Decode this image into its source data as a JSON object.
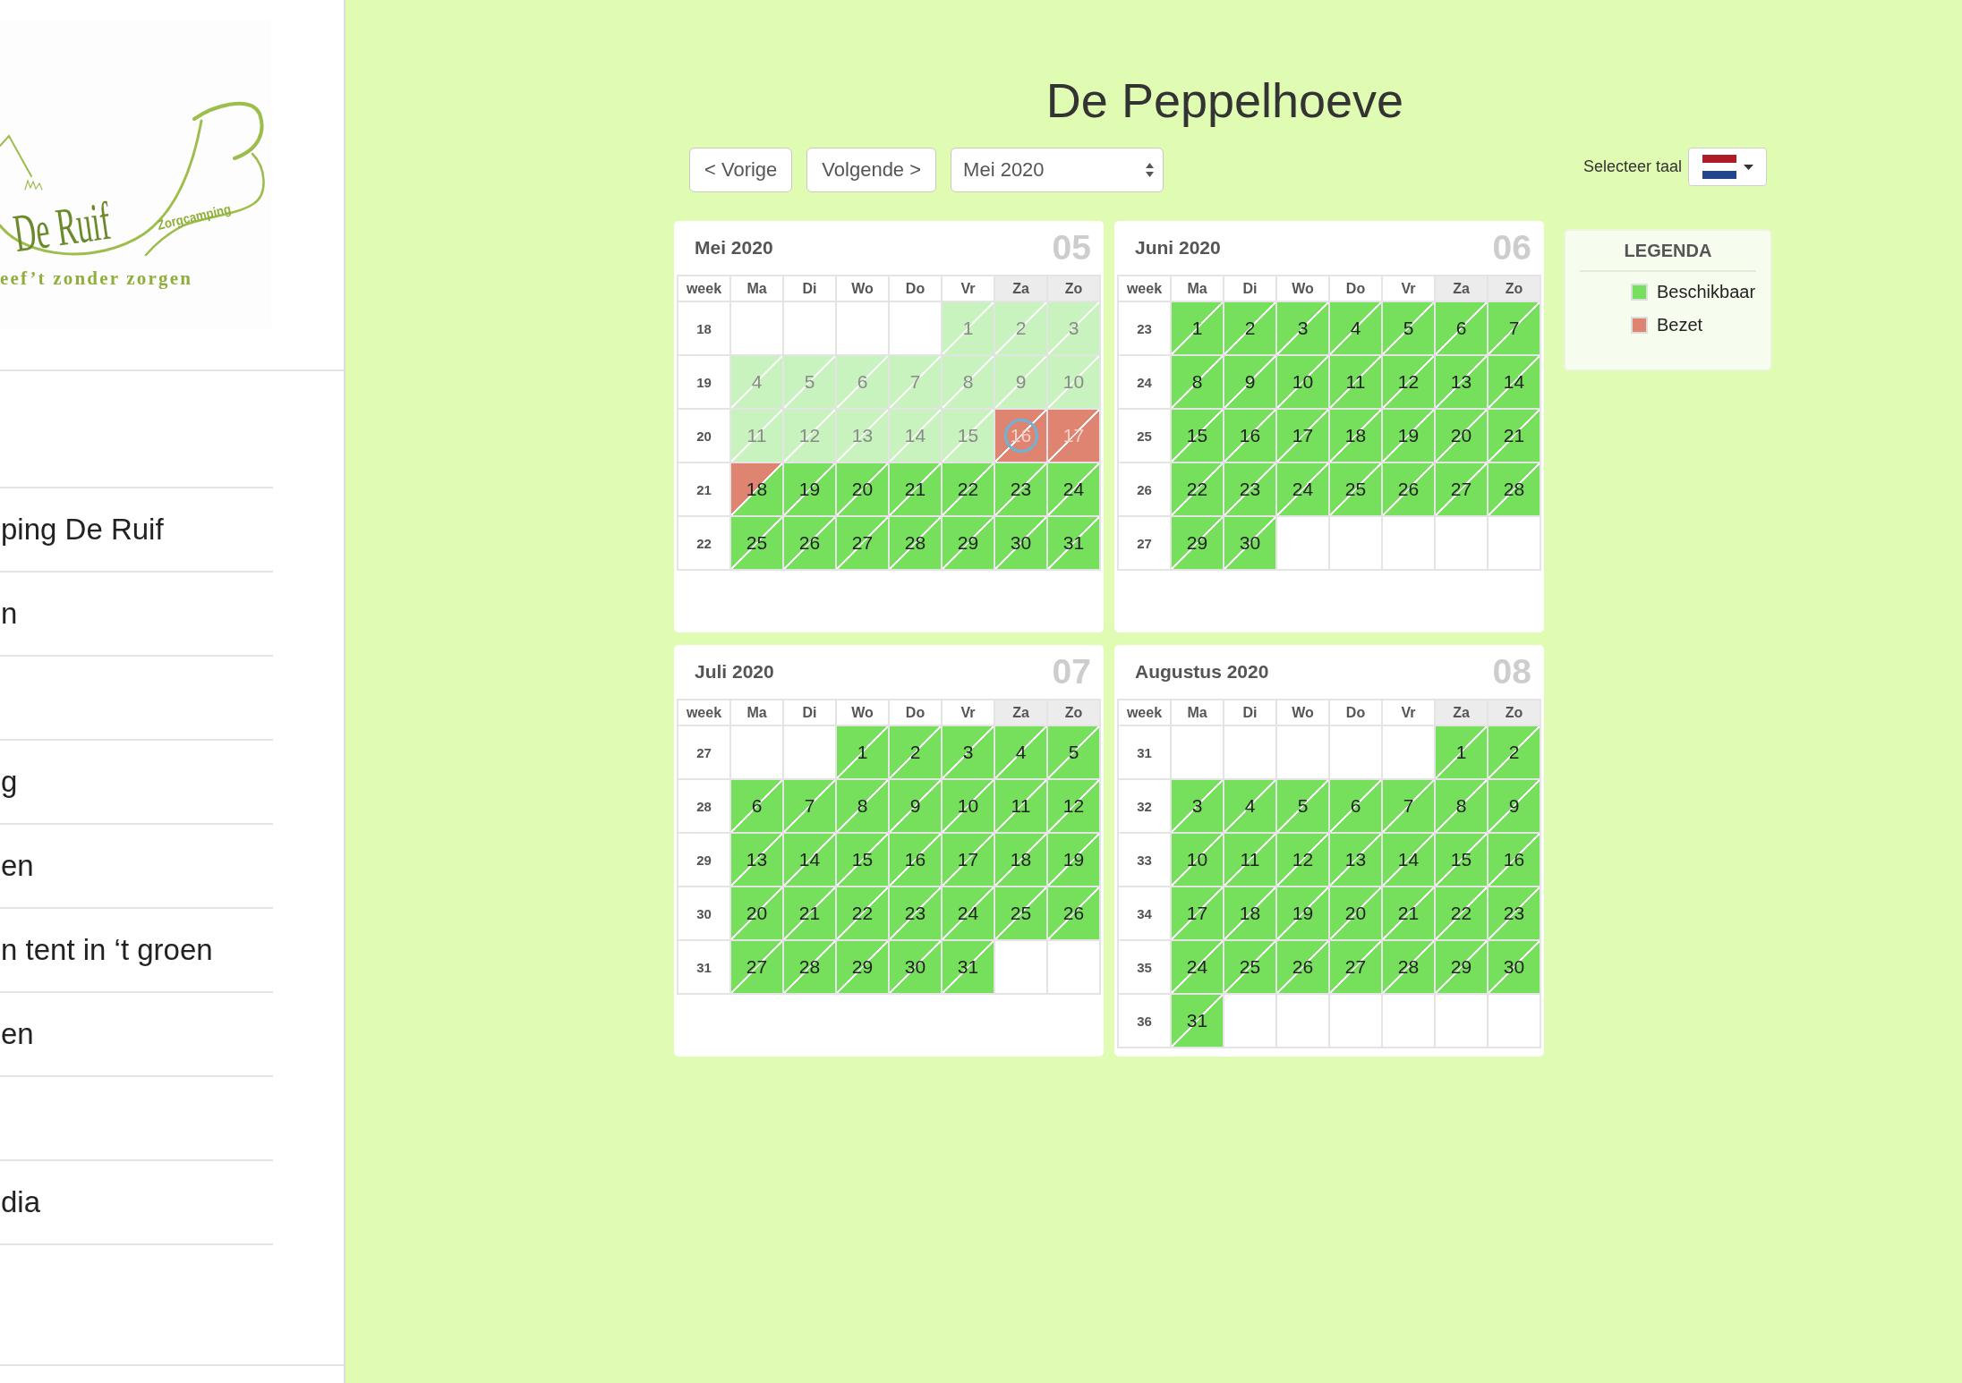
{
  "sidebar": {
    "logo": {
      "name": "De Ruif",
      "tag": "Zorgcamping",
      "slogan": "eef’t zonder zorgen"
    },
    "menu": [
      {
        "kind": "blank"
      },
      {
        "kind": "link",
        "label": "ping De Ruif"
      },
      {
        "kind": "link",
        "label": "n"
      },
      {
        "kind": "blank"
      },
      {
        "kind": "link",
        "label": "g"
      },
      {
        "kind": "link",
        "label": "en"
      },
      {
        "kind": "link",
        "label": "n tent in ‘t groen"
      },
      {
        "kind": "link",
        "label": "en"
      },
      {
        "kind": "blank"
      },
      {
        "kind": "link",
        "label": "dia"
      },
      {
        "kind": "blank"
      }
    ]
  },
  "page": {
    "title": "De Peppelhoeve"
  },
  "toolbar": {
    "previous": "< Vorige",
    "next": "Volgende >",
    "month_select": {
      "value": "Mei 2020"
    },
    "language_label": "Selecteer taal"
  },
  "calendars": [
    {
      "title": "Mei 2020",
      "number": "05",
      "header": [
        {
          "label": "week",
          "shaded": false
        },
        {
          "label": "Ma",
          "shaded": false
        },
        {
          "label": "Di",
          "shaded": false
        },
        {
          "label": "Wo",
          "shaded": false
        },
        {
          "label": "Do",
          "shaded": false
        },
        {
          "label": "Vr",
          "shaded": false
        },
        {
          "label": "Za",
          "shaded": true
        },
        {
          "label": "Zo",
          "shaded": true
        }
      ],
      "weeks": [
        {
          "week": "18",
          "days": [
            {
              "kind": "blank"
            },
            {
              "kind": "blank"
            },
            {
              "kind": "blank"
            },
            {
              "kind": "blank"
            },
            {
              "kind": "day",
              "label": "1",
              "top_booked": false,
              "bottom_booked": false,
              "disabled": true,
              "today": false
            },
            {
              "kind": "day",
              "label": "2",
              "top_booked": false,
              "bottom_booked": false,
              "disabled": true,
              "today": false
            },
            {
              "kind": "day",
              "label": "3",
              "top_booked": false,
              "bottom_booked": false,
              "disabled": true,
              "today": false
            }
          ]
        },
        {
          "week": "19",
          "days": [
            {
              "kind": "day",
              "label": "4",
              "top_booked": false,
              "bottom_booked": false,
              "disabled": true,
              "today": false
            },
            {
              "kind": "day",
              "label": "5",
              "top_booked": false,
              "bottom_booked": false,
              "disabled": true,
              "today": false
            },
            {
              "kind": "day",
              "label": "6",
              "top_booked": false,
              "bottom_booked": false,
              "disabled": true,
              "today": false
            },
            {
              "kind": "day",
              "label": "7",
              "top_booked": false,
              "bottom_booked": false,
              "disabled": true,
              "today": false
            },
            {
              "kind": "day",
              "label": "8",
              "top_booked": false,
              "bottom_booked": false,
              "disabled": true,
              "today": false
            },
            {
              "kind": "day",
              "label": "9",
              "top_booked": false,
              "bottom_booked": false,
              "disabled": true,
              "today": false
            },
            {
              "kind": "day",
              "label": "10",
              "top_booked": false,
              "bottom_booked": false,
              "disabled": true,
              "today": false
            }
          ]
        },
        {
          "week": "20",
          "days": [
            {
              "kind": "day",
              "label": "11",
              "top_booked": false,
              "bottom_booked": false,
              "disabled": true,
              "today": false
            },
            {
              "kind": "day",
              "label": "12",
              "top_booked": false,
              "bottom_booked": false,
              "disabled": true,
              "today": false
            },
            {
              "kind": "day",
              "label": "13",
              "top_booked": false,
              "bottom_booked": false,
              "disabled": true,
              "today": false
            },
            {
              "kind": "day",
              "label": "14",
              "top_booked": false,
              "bottom_booked": false,
              "disabled": true,
              "today": false
            },
            {
              "kind": "day",
              "label": "15",
              "top_booked": false,
              "bottom_booked": false,
              "disabled": true,
              "today": false
            },
            {
              "kind": "day",
              "label": "16",
              "top_booked": true,
              "bottom_booked": true,
              "disabled": true,
              "today": true
            },
            {
              "kind": "day",
              "label": "17",
              "top_booked": true,
              "bottom_booked": true,
              "disabled": true,
              "today": false
            }
          ]
        },
        {
          "week": "21",
          "days": [
            {
              "kind": "day",
              "label": "18",
              "top_booked": true,
              "bottom_booked": false,
              "disabled": false,
              "today": false
            },
            {
              "kind": "day",
              "label": "19",
              "top_booked": false,
              "bottom_booked": false,
              "disabled": false,
              "today": false
            },
            {
              "kind": "day",
              "label": "20",
              "top_booked": false,
              "bottom_booked": false,
              "disabled": false,
              "today": false
            },
            {
              "kind": "day",
              "label": "21",
              "top_booked": false,
              "bottom_booked": false,
              "disabled": false,
              "today": false
            },
            {
              "kind": "day",
              "label": "22",
              "top_booked": false,
              "bottom_booked": false,
              "disabled": false,
              "today": false
            },
            {
              "kind": "day",
              "label": "23",
              "top_booked": false,
              "bottom_booked": false,
              "disabled": false,
              "today": false
            },
            {
              "kind": "day",
              "label": "24",
              "top_booked": false,
              "bottom_booked": false,
              "disabled": false,
              "today": false
            }
          ]
        },
        {
          "week": "22",
          "days": [
            {
              "kind": "day",
              "label": "25",
              "top_booked": false,
              "bottom_booked": false,
              "disabled": false,
              "today": false
            },
            {
              "kind": "day",
              "label": "26",
              "top_booked": false,
              "bottom_booked": false,
              "disabled": false,
              "today": false
            },
            {
              "kind": "day",
              "label": "27",
              "top_booked": false,
              "bottom_booked": false,
              "disabled": false,
              "today": false
            },
            {
              "kind": "day",
              "label": "28",
              "top_booked": false,
              "bottom_booked": false,
              "disabled": false,
              "today": false
            },
            {
              "kind": "day",
              "label": "29",
              "top_booked": false,
              "bottom_booked": false,
              "disabled": false,
              "today": false
            },
            {
              "kind": "day",
              "label": "30",
              "top_booked": false,
              "bottom_booked": false,
              "disabled": false,
              "today": false
            },
            {
              "kind": "day",
              "label": "31",
              "top_booked": false,
              "bottom_booked": false,
              "disabled": false,
              "today": false
            }
          ]
        }
      ]
    },
    {
      "title": "Juni 2020",
      "number": "06",
      "header": [
        {
          "label": "week",
          "shaded": false
        },
        {
          "label": "Ma",
          "shaded": false
        },
        {
          "label": "Di",
          "shaded": false
        },
        {
          "label": "Wo",
          "shaded": false
        },
        {
          "label": "Do",
          "shaded": false
        },
        {
          "label": "Vr",
          "shaded": false
        },
        {
          "label": "Za",
          "shaded": true
        },
        {
          "label": "Zo",
          "shaded": true
        }
      ],
      "weeks": [
        {
          "week": "23",
          "days": [
            {
              "kind": "day",
              "label": "1",
              "top_booked": false,
              "bottom_booked": false,
              "disabled": false,
              "today": false
            },
            {
              "kind": "day",
              "label": "2",
              "top_booked": false,
              "bottom_booked": false,
              "disabled": false,
              "today": false
            },
            {
              "kind": "day",
              "label": "3",
              "top_booked": false,
              "bottom_booked": false,
              "disabled": false,
              "today": false
            },
            {
              "kind": "day",
              "label": "4",
              "top_booked": false,
              "bottom_booked": false,
              "disabled": false,
              "today": false
            },
            {
              "kind": "day",
              "label": "5",
              "top_booked": false,
              "bottom_booked": false,
              "disabled": false,
              "today": false
            },
            {
              "kind": "day",
              "label": "6",
              "top_booked": false,
              "bottom_booked": false,
              "disabled": false,
              "today": false
            },
            {
              "kind": "day",
              "label": "7",
              "top_booked": false,
              "bottom_booked": false,
              "disabled": false,
              "today": false
            }
          ]
        },
        {
          "week": "24",
          "days": [
            {
              "kind": "day",
              "label": "8",
              "top_booked": false,
              "bottom_booked": false,
              "disabled": false,
              "today": false
            },
            {
              "kind": "day",
              "label": "9",
              "top_booked": false,
              "bottom_booked": false,
              "disabled": false,
              "today": false
            },
            {
              "kind": "day",
              "label": "10",
              "top_booked": false,
              "bottom_booked": false,
              "disabled": false,
              "today": false
            },
            {
              "kind": "day",
              "label": "11",
              "top_booked": false,
              "bottom_booked": false,
              "disabled": false,
              "today": false
            },
            {
              "kind": "day",
              "label": "12",
              "top_booked": false,
              "bottom_booked": false,
              "disabled": false,
              "today": false
            },
            {
              "kind": "day",
              "label": "13",
              "top_booked": false,
              "bottom_booked": false,
              "disabled": false,
              "today": false
            },
            {
              "kind": "day",
              "label": "14",
              "top_booked": false,
              "bottom_booked": false,
              "disabled": false,
              "today": false
            }
          ]
        },
        {
          "week": "25",
          "days": [
            {
              "kind": "day",
              "label": "15",
              "top_booked": false,
              "bottom_booked": false,
              "disabled": false,
              "today": false
            },
            {
              "kind": "day",
              "label": "16",
              "top_booked": false,
              "bottom_booked": false,
              "disabled": false,
              "today": false
            },
            {
              "kind": "day",
              "label": "17",
              "top_booked": false,
              "bottom_booked": false,
              "disabled": false,
              "today": false
            },
            {
              "kind": "day",
              "label": "18",
              "top_booked": false,
              "bottom_booked": false,
              "disabled": false,
              "today": false
            },
            {
              "kind": "day",
              "label": "19",
              "top_booked": false,
              "bottom_booked": false,
              "disabled": false,
              "today": false
            },
            {
              "kind": "day",
              "label": "20",
              "top_booked": false,
              "bottom_booked": false,
              "disabled": false,
              "today": false
            },
            {
              "kind": "day",
              "label": "21",
              "top_booked": false,
              "bottom_booked": false,
              "disabled": false,
              "today": false
            }
          ]
        },
        {
          "week": "26",
          "days": [
            {
              "kind": "day",
              "label": "22",
              "top_booked": false,
              "bottom_booked": false,
              "disabled": false,
              "today": false
            },
            {
              "kind": "day",
              "label": "23",
              "top_booked": false,
              "bottom_booked": false,
              "disabled": false,
              "today": false
            },
            {
              "kind": "day",
              "label": "24",
              "top_booked": false,
              "bottom_booked": false,
              "disabled": false,
              "today": false
            },
            {
              "kind": "day",
              "label": "25",
              "top_booked": false,
              "bottom_booked": false,
              "disabled": false,
              "today": false
            },
            {
              "kind": "day",
              "label": "26",
              "top_booked": false,
              "bottom_booked": false,
              "disabled": false,
              "today": false
            },
            {
              "kind": "day",
              "label": "27",
              "top_booked": false,
              "bottom_booked": false,
              "disabled": false,
              "today": false
            },
            {
              "kind": "day",
              "label": "28",
              "top_booked": false,
              "bottom_booked": false,
              "disabled": false,
              "today": false
            }
          ]
        },
        {
          "week": "27",
          "days": [
            {
              "kind": "day",
              "label": "29",
              "top_booked": false,
              "bottom_booked": false,
              "disabled": false,
              "today": false
            },
            {
              "kind": "day",
              "label": "30",
              "top_booked": false,
              "bottom_booked": false,
              "disabled": false,
              "today": false
            },
            {
              "kind": "blank"
            },
            {
              "kind": "blank"
            },
            {
              "kind": "blank"
            },
            {
              "kind": "blank"
            },
            {
              "kind": "blank"
            }
          ]
        }
      ]
    },
    {
      "title": "Juli 2020",
      "number": "07",
      "header": [
        {
          "label": "week",
          "shaded": false
        },
        {
          "label": "Ma",
          "shaded": false
        },
        {
          "label": "Di",
          "shaded": false
        },
        {
          "label": "Wo",
          "shaded": false
        },
        {
          "label": "Do",
          "shaded": false
        },
        {
          "label": "Vr",
          "shaded": false
        },
        {
          "label": "Za",
          "shaded": true
        },
        {
          "label": "Zo",
          "shaded": true
        }
      ],
      "weeks": [
        {
          "week": "27",
          "days": [
            {
              "kind": "blank"
            },
            {
              "kind": "blank"
            },
            {
              "kind": "day",
              "label": "1",
              "top_booked": false,
              "bottom_booked": false,
              "disabled": false,
              "today": false
            },
            {
              "kind": "day",
              "label": "2",
              "top_booked": false,
              "bottom_booked": false,
              "disabled": false,
              "today": false
            },
            {
              "kind": "day",
              "label": "3",
              "top_booked": false,
              "bottom_booked": false,
              "disabled": false,
              "today": false
            },
            {
              "kind": "day",
              "label": "4",
              "top_booked": false,
              "bottom_booked": false,
              "disabled": false,
              "today": false
            },
            {
              "kind": "day",
              "label": "5",
              "top_booked": false,
              "bottom_booked": false,
              "disabled": false,
              "today": false
            }
          ]
        },
        {
          "week": "28",
          "days": [
            {
              "kind": "day",
              "label": "6",
              "top_booked": false,
              "bottom_booked": false,
              "disabled": false,
              "today": false
            },
            {
              "kind": "day",
              "label": "7",
              "top_booked": false,
              "bottom_booked": false,
              "disabled": false,
              "today": false
            },
            {
              "kind": "day",
              "label": "8",
              "top_booked": false,
              "bottom_booked": false,
              "disabled": false,
              "today": false
            },
            {
              "kind": "day",
              "label": "9",
              "top_booked": false,
              "bottom_booked": false,
              "disabled": false,
              "today": false
            },
            {
              "kind": "day",
              "label": "10",
              "top_booked": false,
              "bottom_booked": false,
              "disabled": false,
              "today": false
            },
            {
              "kind": "day",
              "label": "11",
              "top_booked": false,
              "bottom_booked": false,
              "disabled": false,
              "today": false
            },
            {
              "kind": "day",
              "label": "12",
              "top_booked": false,
              "bottom_booked": false,
              "disabled": false,
              "today": false
            }
          ]
        },
        {
          "week": "29",
          "days": [
            {
              "kind": "day",
              "label": "13",
              "top_booked": false,
              "bottom_booked": false,
              "disabled": false,
              "today": false
            },
            {
              "kind": "day",
              "label": "14",
              "top_booked": false,
              "bottom_booked": false,
              "disabled": false,
              "today": false
            },
            {
              "kind": "day",
              "label": "15",
              "top_booked": false,
              "bottom_booked": false,
              "disabled": false,
              "today": false
            },
            {
              "kind": "day",
              "label": "16",
              "top_booked": false,
              "bottom_booked": false,
              "disabled": false,
              "today": false
            },
            {
              "kind": "day",
              "label": "17",
              "top_booked": false,
              "bottom_booked": false,
              "disabled": false,
              "today": false
            },
            {
              "kind": "day",
              "label": "18",
              "top_booked": false,
              "bottom_booked": false,
              "disabled": false,
              "today": false
            },
            {
              "kind": "day",
              "label": "19",
              "top_booked": false,
              "bottom_booked": false,
              "disabled": false,
              "today": false
            }
          ]
        },
        {
          "week": "30",
          "days": [
            {
              "kind": "day",
              "label": "20",
              "top_booked": false,
              "bottom_booked": false,
              "disabled": false,
              "today": false
            },
            {
              "kind": "day",
              "label": "21",
              "top_booked": false,
              "bottom_booked": false,
              "disabled": false,
              "today": false
            },
            {
              "kind": "day",
              "label": "22",
              "top_booked": false,
              "bottom_booked": false,
              "disabled": false,
              "today": false
            },
            {
              "kind": "day",
              "label": "23",
              "top_booked": false,
              "bottom_booked": false,
              "disabled": false,
              "today": false
            },
            {
              "kind": "day",
              "label": "24",
              "top_booked": false,
              "bottom_booked": false,
              "disabled": false,
              "today": false
            },
            {
              "kind": "day",
              "label": "25",
              "top_booked": false,
              "bottom_booked": false,
              "disabled": false,
              "today": false
            },
            {
              "kind": "day",
              "label": "26",
              "top_booked": false,
              "bottom_booked": false,
              "disabled": false,
              "today": false
            }
          ]
        },
        {
          "week": "31",
          "days": [
            {
              "kind": "day",
              "label": "27",
              "top_booked": false,
              "bottom_booked": false,
              "disabled": false,
              "today": false
            },
            {
              "kind": "day",
              "label": "28",
              "top_booked": false,
              "bottom_booked": false,
              "disabled": false,
              "today": false
            },
            {
              "kind": "day",
              "label": "29",
              "top_booked": false,
              "bottom_booked": false,
              "disabled": false,
              "today": false
            },
            {
              "kind": "day",
              "label": "30",
              "top_booked": false,
              "bottom_booked": false,
              "disabled": false,
              "today": false
            },
            {
              "kind": "day",
              "label": "31",
              "top_booked": false,
              "bottom_booked": false,
              "disabled": false,
              "today": false
            },
            {
              "kind": "blank"
            },
            {
              "kind": "blank"
            }
          ]
        }
      ]
    },
    {
      "title": "Augustus 2020",
      "number": "08",
      "header": [
        {
          "label": "week",
          "shaded": false
        },
        {
          "label": "Ma",
          "shaded": false
        },
        {
          "label": "Di",
          "shaded": false
        },
        {
          "label": "Wo",
          "shaded": false
        },
        {
          "label": "Do",
          "shaded": false
        },
        {
          "label": "Vr",
          "shaded": false
        },
        {
          "label": "Za",
          "shaded": true
        },
        {
          "label": "Zo",
          "shaded": true
        }
      ],
      "weeks": [
        {
          "week": "31",
          "days": [
            {
              "kind": "blank"
            },
            {
              "kind": "blank"
            },
            {
              "kind": "blank"
            },
            {
              "kind": "blank"
            },
            {
              "kind": "blank"
            },
            {
              "kind": "day",
              "label": "1",
              "top_booked": false,
              "bottom_booked": false,
              "disabled": false,
              "today": false
            },
            {
              "kind": "day",
              "label": "2",
              "top_booked": false,
              "bottom_booked": false,
              "disabled": false,
              "today": false
            }
          ]
        },
        {
          "week": "32",
          "days": [
            {
              "kind": "day",
              "label": "3",
              "top_booked": false,
              "bottom_booked": false,
              "disabled": false,
              "today": false
            },
            {
              "kind": "day",
              "label": "4",
              "top_booked": false,
              "bottom_booked": false,
              "disabled": false,
              "today": false
            },
            {
              "kind": "day",
              "label": "5",
              "top_booked": false,
              "bottom_booked": false,
              "disabled": false,
              "today": false
            },
            {
              "kind": "day",
              "label": "6",
              "top_booked": false,
              "bottom_booked": false,
              "disabled": false,
              "today": false
            },
            {
              "kind": "day",
              "label": "7",
              "top_booked": false,
              "bottom_booked": false,
              "disabled": false,
              "today": false
            },
            {
              "kind": "day",
              "label": "8",
              "top_booked": false,
              "bottom_booked": false,
              "disabled": false,
              "today": false
            },
            {
              "kind": "day",
              "label": "9",
              "top_booked": false,
              "bottom_booked": false,
              "disabled": false,
              "today": false
            }
          ]
        },
        {
          "week": "33",
          "days": [
            {
              "kind": "day",
              "label": "10",
              "top_booked": false,
              "bottom_booked": false,
              "disabled": false,
              "today": false
            },
            {
              "kind": "day",
              "label": "11",
              "top_booked": false,
              "bottom_booked": false,
              "disabled": false,
              "today": false
            },
            {
              "kind": "day",
              "label": "12",
              "top_booked": false,
              "bottom_booked": false,
              "disabled": false,
              "today": false
            },
            {
              "kind": "day",
              "label": "13",
              "top_booked": false,
              "bottom_booked": false,
              "disabled": false,
              "today": false
            },
            {
              "kind": "day",
              "label": "14",
              "top_booked": false,
              "bottom_booked": false,
              "disabled": false,
              "today": false
            },
            {
              "kind": "day",
              "label": "15",
              "top_booked": false,
              "bottom_booked": false,
              "disabled": false,
              "today": false
            },
            {
              "kind": "day",
              "label": "16",
              "top_booked": false,
              "bottom_booked": false,
              "disabled": false,
              "today": false
            }
          ]
        },
        {
          "week": "34",
          "days": [
            {
              "kind": "day",
              "label": "17",
              "top_booked": false,
              "bottom_booked": false,
              "disabled": false,
              "today": false
            },
            {
              "kind": "day",
              "label": "18",
              "top_booked": false,
              "bottom_booked": false,
              "disabled": false,
              "today": false
            },
            {
              "kind": "day",
              "label": "19",
              "top_booked": false,
              "bottom_booked": false,
              "disabled": false,
              "today": false
            },
            {
              "kind": "day",
              "label": "20",
              "top_booked": false,
              "bottom_booked": false,
              "disabled": false,
              "today": false
            },
            {
              "kind": "day",
              "label": "21",
              "top_booked": false,
              "bottom_booked": false,
              "disabled": false,
              "today": false
            },
            {
              "kind": "day",
              "label": "22",
              "top_booked": false,
              "bottom_booked": false,
              "disabled": false,
              "today": false
            },
            {
              "kind": "day",
              "label": "23",
              "top_booked": false,
              "bottom_booked": false,
              "disabled": false,
              "today": false
            }
          ]
        },
        {
          "week": "35",
          "days": [
            {
              "kind": "day",
              "label": "24",
              "top_booked": false,
              "bottom_booked": false,
              "disabled": false,
              "today": false
            },
            {
              "kind": "day",
              "label": "25",
              "top_booked": false,
              "bottom_booked": false,
              "disabled": false,
              "today": false
            },
            {
              "kind": "day",
              "label": "26",
              "top_booked": false,
              "bottom_booked": false,
              "disabled": false,
              "today": false
            },
            {
              "kind": "day",
              "label": "27",
              "top_booked": false,
              "bottom_booked": false,
              "disabled": false,
              "today": false
            },
            {
              "kind": "day",
              "label": "28",
              "top_booked": false,
              "bottom_booked": false,
              "disabled": false,
              "today": false
            },
            {
              "kind": "day",
              "label": "29",
              "top_booked": false,
              "bottom_booked": false,
              "disabled": false,
              "today": false
            },
            {
              "kind": "day",
              "label": "30",
              "top_booked": false,
              "bottom_booked": false,
              "disabled": false,
              "today": false
            }
          ]
        },
        {
          "week": "36",
          "days": [
            {
              "kind": "day",
              "label": "31",
              "top_booked": false,
              "bottom_booked": false,
              "disabled": false,
              "today": false
            },
            {
              "kind": "blank"
            },
            {
              "kind": "blank"
            },
            {
              "kind": "blank"
            },
            {
              "kind": "blank"
            },
            {
              "kind": "blank"
            },
            {
              "kind": "blank"
            }
          ]
        }
      ]
    }
  ],
  "legend": {
    "title": "LEGENDA",
    "items": [
      {
        "label": "Beschikbaar",
        "color": "#76e05c"
      },
      {
        "label": "Bezet",
        "color": "#e08472"
      }
    ]
  }
}
